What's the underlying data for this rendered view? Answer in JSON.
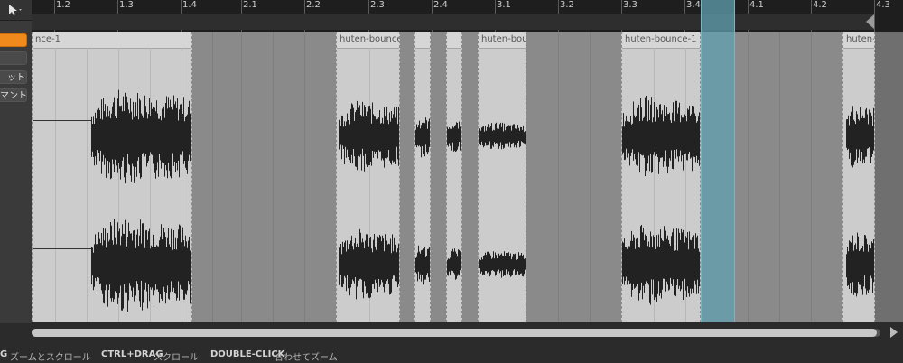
{
  "toolbar": {
    "pointer_tool": "pointer-arrow-icon"
  },
  "side_buttons": [
    {
      "label": "",
      "state": "active"
    },
    {
      "label": "",
      "state": "normal"
    },
    {
      "label": "ット",
      "state": "normal"
    },
    {
      "label": "マント",
      "state": "normal"
    }
  ],
  "ruler": {
    "labels": [
      "1.2",
      "1.3",
      "1.4",
      "2.1",
      "2.2",
      "2.3",
      "2.4",
      "3.1",
      "3.2",
      "3.3",
      "3.4",
      "4.1",
      "4.2",
      "4.3"
    ]
  },
  "clips": [
    {
      "name": "nce-1"
    },
    {
      "name": "huten-bounce-1"
    },
    {
      "name": ""
    },
    {
      "name": ""
    },
    {
      "name": "huten-bounc"
    },
    {
      "name": "huten-bounce-1"
    },
    {
      "name": "huten-b"
    }
  ],
  "status_bar": {
    "hint1_key": "G",
    "hint1_text": "ズームとスクロール",
    "hint2_key": "CTRL+DRAG",
    "hint2_text": "スクロール",
    "hint3_key": "DOUBLE-CLICK",
    "hint3_text": "合わせてズーム"
  },
  "colors": {
    "active_button": "#f08a1c",
    "selection": "#5fa0af",
    "clip_bg": "#cccccc",
    "waveform": "#222222"
  }
}
